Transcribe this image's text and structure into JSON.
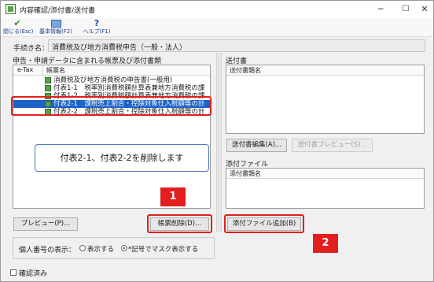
{
  "window": {
    "title": "内容確認/添付書/送付書",
    "controls": {
      "minimize": "─",
      "maximize": "☐",
      "close": "✕"
    }
  },
  "toolbar": {
    "close_label": "閉じる(Esc)",
    "basic_info_label": "基本情報(F2)",
    "help_label": "ヘルプ(F1)",
    "close_icon": "✔",
    "help_icon": "?"
  },
  "procedure": {
    "label": "手続き名：",
    "value": "消費税及び地方消費税申告（一般・法人）"
  },
  "left": {
    "section_label": "申告・申請データに含まれる帳票及び添付書類",
    "columns": [
      "e-Tax",
      "帳票名"
    ],
    "rows": [
      {
        "name": "消費税及び地方消費税の申告書(一般用)",
        "selected": false
      },
      {
        "name": "付表1-1　税率別消費税額計算表兼地方消費税の課",
        "selected": false
      },
      {
        "name": "付表1-2　税率別消費税額計算表兼地方消費税の課",
        "selected": false
      },
      {
        "name": "付表2-1　課税売上割合・控除対象仕入税額等の計",
        "selected": true
      },
      {
        "name": "付表2-2　課税売上割合・控除対象仕入税額等の計",
        "selected": false
      }
    ],
    "preview_button": "プレビュー(P)...",
    "delete_button": "帳票削除(D)..."
  },
  "callout": {
    "text": "付表2-1、付表2-2を削除します"
  },
  "badges": {
    "one": "1",
    "two": "2"
  },
  "right": {
    "sending": {
      "section_label": "送付書",
      "column": "送付書類名",
      "edit_button": "送付書編集(A)...",
      "preview_button": "送付書プレビュー(S)..."
    },
    "attachment": {
      "section_label": "添付ファイル",
      "column": "添付書類名",
      "add_button": "添付ファイル追加(B)"
    }
  },
  "mynumber": {
    "label": "個人番号の表示：",
    "option_show": "表示する",
    "option_mask": "*記号でマスク表示する",
    "selected": "mask"
  },
  "confirm": {
    "label": "確認済み",
    "checked": false
  },
  "colors": {
    "highlight": "#e01f1f",
    "selection": "#1c62c8",
    "callout_border": "#4a78b8",
    "doc_icon": "#5aa14a"
  }
}
